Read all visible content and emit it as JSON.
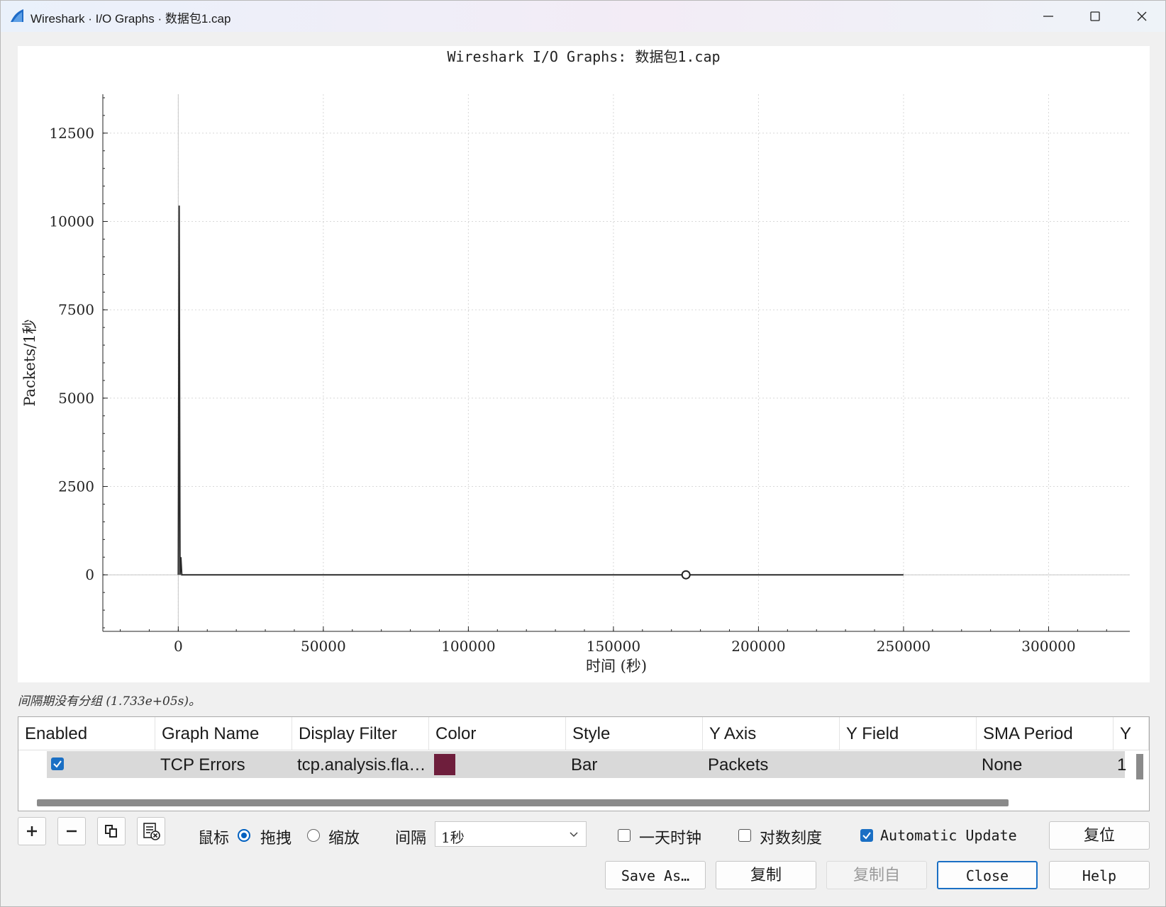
{
  "window": {
    "title": "Wireshark · I/O Graphs · 数据包1.cap"
  },
  "chart_data": {
    "type": "bar",
    "title": "Wireshark I/O Graphs: 数据包1.cap",
    "xlabel": "时间 (秒)",
    "ylabel": "Packets/1秒",
    "xlim": [
      -26000,
      328000
    ],
    "ylim": [
      -1600,
      13600
    ],
    "x_ticks": [
      0,
      50000,
      100000,
      150000,
      200000,
      250000,
      300000
    ],
    "x_tick_labels": [
      "0",
      "50000",
      "100000",
      "150000",
      "200000",
      "250000",
      "300000"
    ],
    "y_ticks": [
      0,
      2500,
      5000,
      7500,
      10000,
      12500
    ],
    "y_tick_labels": [
      "0",
      "2500",
      "5000",
      "7500",
      "10000",
      "12500"
    ],
    "grid": true,
    "series": [
      {
        "name": "TCP Errors",
        "color": "#2b2b2b",
        "points": [
          {
            "x": 0,
            "y": 0
          },
          {
            "x": 300,
            "y": 10450
          },
          {
            "x": 600,
            "y": 0
          },
          {
            "x": 900,
            "y": 500
          },
          {
            "x": 1200,
            "y": 0
          },
          {
            "x": 250000,
            "y": 0
          }
        ]
      }
    ],
    "marker": {
      "x": 175000,
      "y": 0
    }
  },
  "status": {
    "text": "间隔期没有分组 (1.733e+05s)。"
  },
  "table": {
    "headers": [
      "Enabled",
      "Graph Name",
      "Display Filter",
      "Color",
      "Style",
      "Y Axis",
      "Y Field",
      "SMA Period",
      "Y"
    ],
    "rows": [
      {
        "enabled": true,
        "graph_name": "TCP Errors",
        "display_filter": "tcp.analysis.fla…",
        "color": "#6e1e3c",
        "style": "Bar",
        "y_axis": "Packets",
        "y_field": "",
        "sma_period": "None",
        "y_more": "1"
      }
    ]
  },
  "controls": {
    "mouse_label": "鼠标",
    "drag_label": "拖拽",
    "zoom_label": "缩放",
    "mouse_mode": "drag",
    "interval_label": "间隔",
    "interval_value": "1秒",
    "time_of_day_label": "一天时钟",
    "time_of_day": false,
    "log_scale_label": "对数刻度",
    "log_scale": false,
    "auto_update_label": "Automatic Update",
    "auto_update": true
  },
  "buttons": {
    "reset": "复位",
    "save_as": "Save As…",
    "copy": "复制",
    "copy_from": "复制自",
    "close": "Close",
    "help": "Help"
  }
}
